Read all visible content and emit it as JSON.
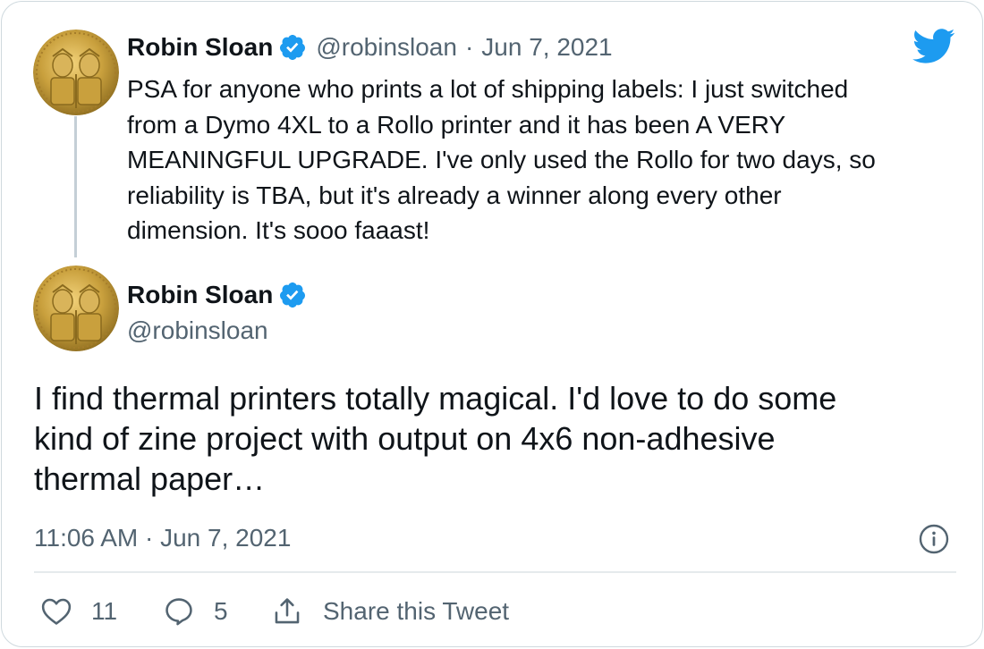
{
  "parent_tweet": {
    "author_name": "Robin Sloan",
    "handle": "@robinsloan",
    "separator": "·",
    "date": "Jun 7, 2021",
    "lines": [
      "PSA for anyone who prints a lot of shipping labels: I just switched",
      "from a Dymo 4XL to a Rollo printer and it has been A VERY",
      "MEANINGFUL UPGRADE. I've only used the Rollo for two days, so",
      "reliability is TBA, but it's already a winner along every other",
      "dimension. It's sooo faaast!"
    ]
  },
  "main_tweet": {
    "author_name": "Robin Sloan",
    "handle": "@robinsloan",
    "lines": [
      "I find thermal printers totally magical. I'd love to do some",
      "kind of zine project with output on 4x6 non-adhesive",
      "thermal paper…"
    ],
    "timestamp": "11:06 AM · Jun 7, 2021"
  },
  "actions": {
    "like_count": "11",
    "reply_count": "5",
    "share_label": "Share this Tweet"
  },
  "icons": {
    "brand": "twitter-bird-icon",
    "verified": "verified-badge-icon",
    "info": "info-icon",
    "like": "heart-icon",
    "reply": "reply-bubble-icon",
    "share": "share-icon"
  },
  "colors": {
    "twitter_blue": "#1d9bf0",
    "text_primary": "#0f1419",
    "text_secondary": "#536471",
    "border": "#cfd9de"
  }
}
